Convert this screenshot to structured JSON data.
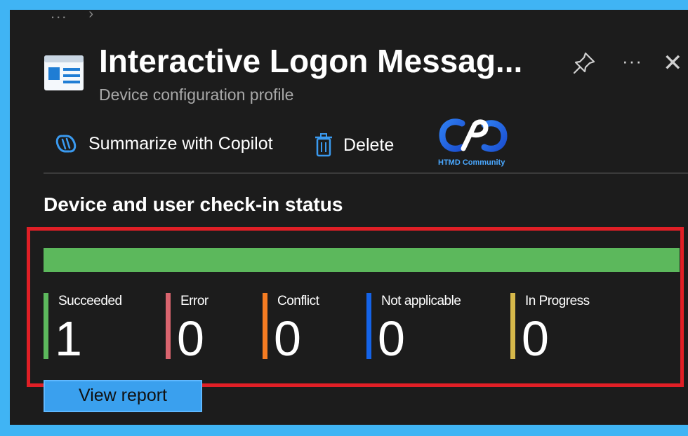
{
  "breadcrumb": {
    "ellipsis": "...",
    "separator": "›"
  },
  "header": {
    "title": "Interactive Logon Messag...",
    "subtitle": "Device configuration profile",
    "pin_icon": "pin-icon",
    "more_label": "···",
    "close_label": "✕"
  },
  "toolbar": {
    "copilot_label": "Summarize with Copilot",
    "copilot_icon": "copilot-icon",
    "delete_label": "Delete",
    "delete_icon": "trash-icon"
  },
  "watermark": {
    "caption": "HTMD Community"
  },
  "section": {
    "title": "Device and user check-in status",
    "progress_fraction": 1.0,
    "progress_color": "#5cb85c",
    "statuses": [
      {
        "label": "Succeeded",
        "count": "1",
        "color": "#5cb85c"
      },
      {
        "label": "Error",
        "count": "0",
        "color": "#d9646e"
      },
      {
        "label": "Conflict",
        "count": "0",
        "color": "#f57c22"
      },
      {
        "label": "Not applicable",
        "count": "0",
        "color": "#1463e8"
      },
      {
        "label": "In Progress",
        "count": "0",
        "color": "#d6b84a"
      }
    ]
  },
  "actions": {
    "view_report_label": "View report"
  },
  "colors": {
    "accent": "#3aa0ee",
    "highlight": "#e01f26",
    "page_border": "#40b4f4"
  }
}
